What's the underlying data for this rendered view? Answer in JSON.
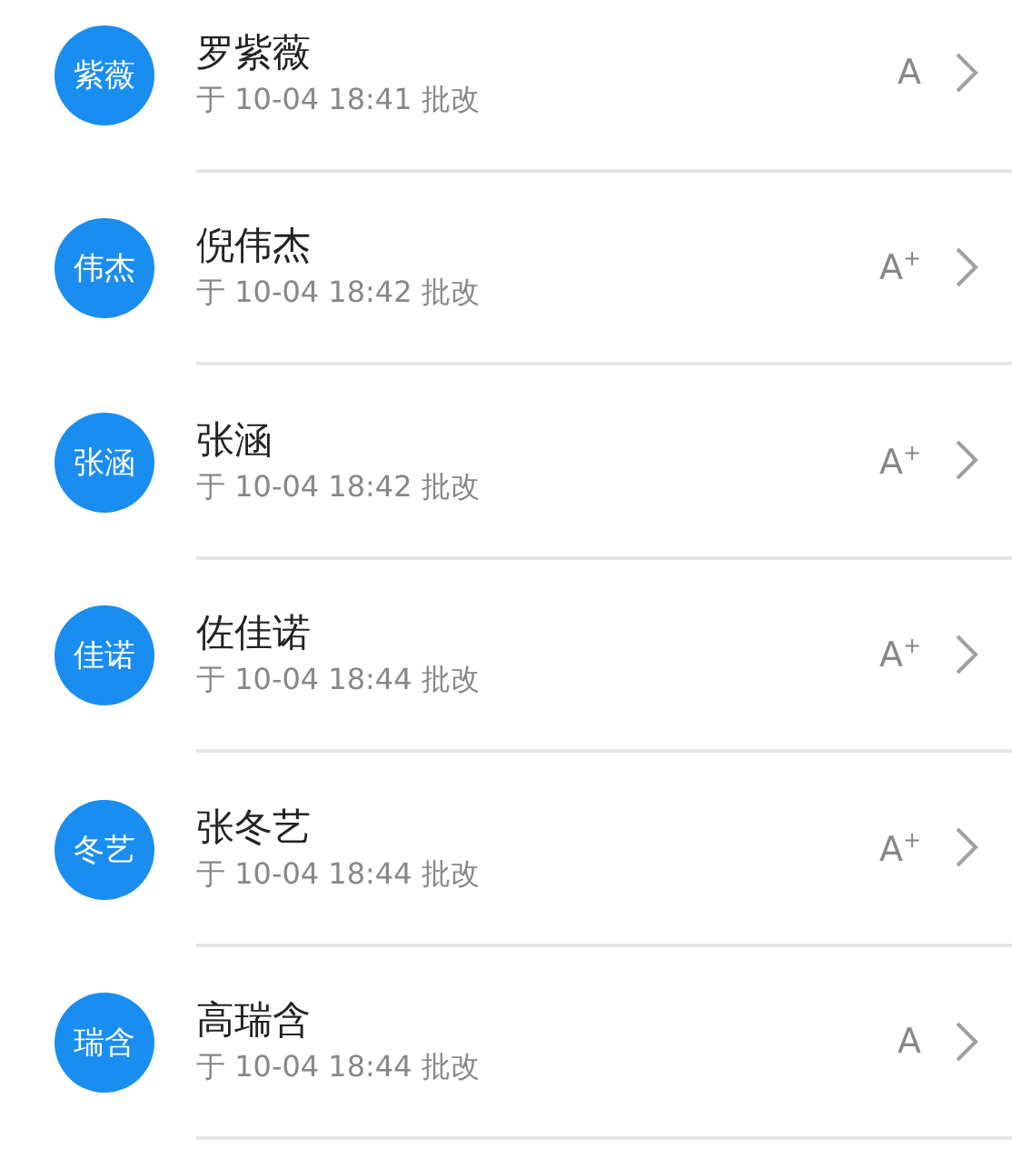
{
  "students": [
    {
      "avatar": "紫薇",
      "name": "罗紫薇",
      "time": "于 10-04 18:41 批改",
      "grade": "A"
    },
    {
      "avatar": "伟杰",
      "name": "倪伟杰",
      "time": "于 10-04 18:42 批改",
      "grade": "A$^{+}$"
    },
    {
      "avatar": "张涵",
      "name": "张涵",
      "time": "于 10-04 18:42 批改",
      "grade": "A$^{+}$"
    },
    {
      "avatar": "佳诺",
      "name": "佐佳诺",
      "time": "于 10-04 18:44 批改",
      "grade": "A$^{+}$"
    },
    {
      "avatar": "冬艺",
      "name": "张冬艺",
      "time": "于 10-04 18:44 批改",
      "grade": "A$^{+}$"
    },
    {
      "avatar": "瑞含",
      "name": "高瑞含",
      "time": "于 10-04 18:44 批改",
      "grade": "A"
    }
  ]
}
